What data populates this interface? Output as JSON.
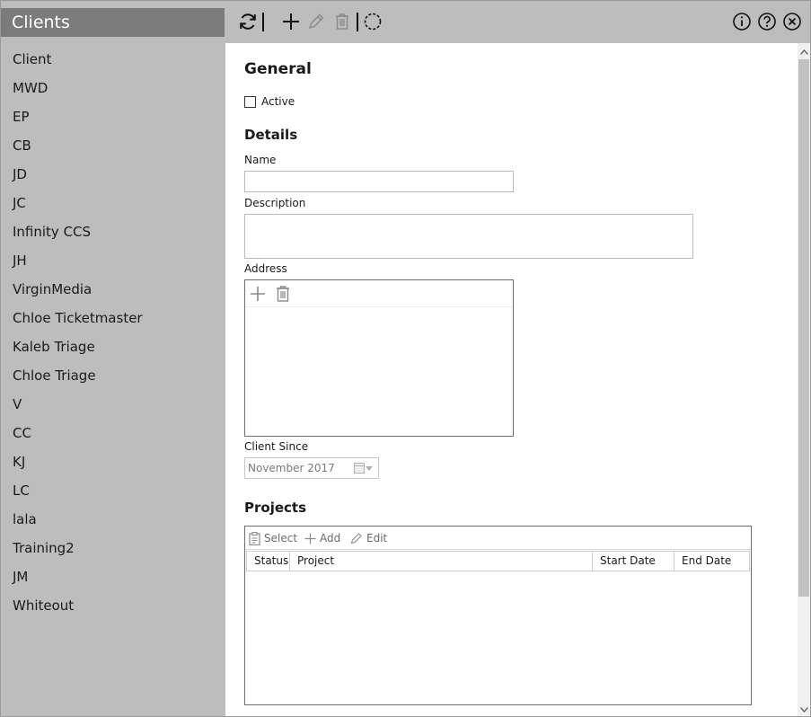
{
  "sidebar": {
    "title": "Clients",
    "items": [
      "Client",
      "MWD",
      "EP",
      "CB",
      "JD",
      "JC",
      "Infinity CCS",
      "JH",
      "VirginMedia",
      "Chloe Ticketmaster",
      "Kaleb Triage",
      "Chloe Triage",
      "V",
      "CC",
      "KJ",
      "LC",
      "lala",
      "Training2",
      "JM",
      "Whiteout"
    ]
  },
  "toolbar": {
    "icons": [
      "refresh-icon",
      "add-icon",
      "edit-icon",
      "delete-icon",
      "circle-dashed-icon",
      "info-icon",
      "help-icon",
      "close-icon"
    ]
  },
  "form": {
    "general_heading": "General",
    "active_label": "Active",
    "active_checked": false,
    "details_heading": "Details",
    "name_label": "Name",
    "name_value": "",
    "description_label": "Description",
    "description_value": "",
    "address_label": "Address",
    "client_since_label": "Client Since",
    "client_since_value": "November 2017",
    "projects_heading": "Projects"
  },
  "projects": {
    "toolbar": {
      "select": "Select",
      "add": "Add",
      "edit": "Edit"
    },
    "columns": [
      "Status",
      "Project",
      "Start Date",
      "End Date"
    ],
    "rows": []
  },
  "colors": {
    "sidebar_bg": "#bdbdbd",
    "sidebar_title_bg": "#7b7b7b",
    "content_bg": "#ffffff"
  }
}
